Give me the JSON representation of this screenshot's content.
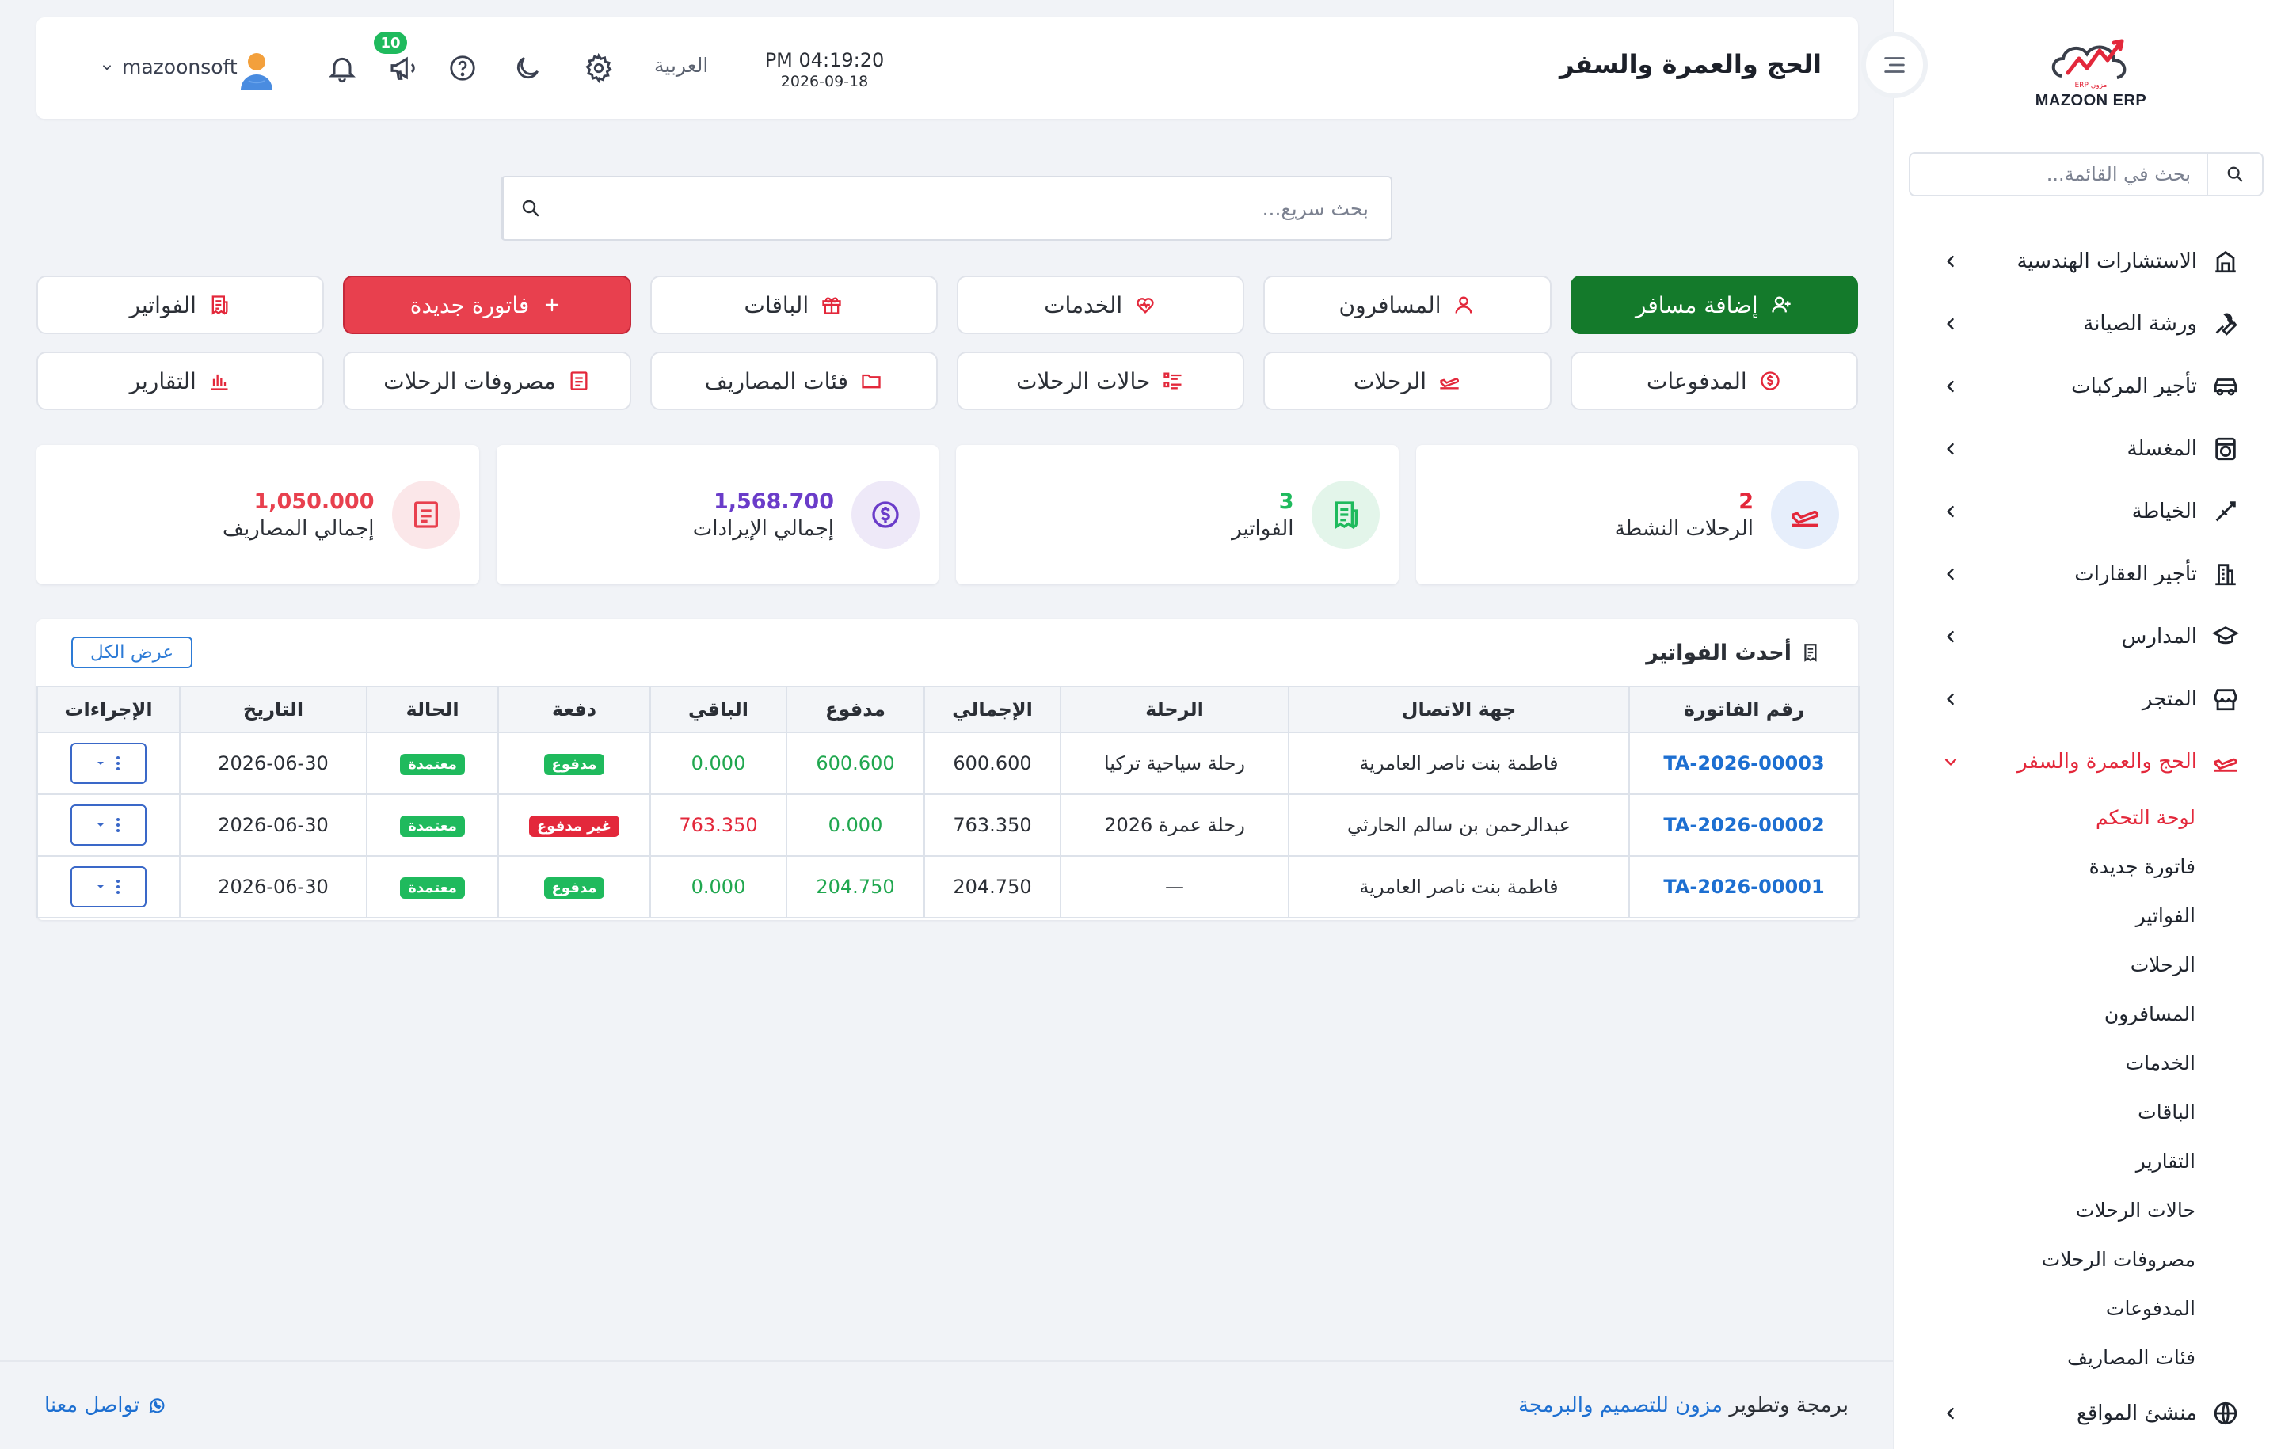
{
  "app": {
    "logo_text": "MAZOON ERP",
    "logo_subtext": "ERP مزون"
  },
  "header": {
    "page_title": "الحج والعمرة والسفر",
    "time": "PM 04:19:20",
    "date": "2026-09-18",
    "language": "العربية",
    "notification_count": "10",
    "username": "mazoonsoft"
  },
  "sidebar": {
    "search_placeholder": "بحث في القائمة...",
    "items": [
      {
        "label": "الاستشارات الهندسية",
        "icon": "building-columns-icon"
      },
      {
        "label": "ورشة الصيانة",
        "icon": "wrench-icon"
      },
      {
        "label": "تأجير المركبات",
        "icon": "car-icon"
      },
      {
        "label": "المغسلة",
        "icon": "laundry-icon"
      },
      {
        "label": "الخياطة",
        "icon": "needle-icon"
      },
      {
        "label": "تأجير العقارات",
        "icon": "buildings-icon"
      },
      {
        "label": "المدارس",
        "icon": "graduation-cap-icon"
      },
      {
        "label": "المتجر",
        "icon": "store-icon"
      },
      {
        "label": "الحج والعمرة والسفر",
        "icon": "plane-icon",
        "active": true
      }
    ],
    "sub_items": [
      "لوحة التحكم",
      "فاتورة جديدة",
      "الفواتير",
      "الرحلات",
      "المسافرون",
      "الخدمات",
      "الباقات",
      "التقارير",
      "حالات الرحلات",
      "مصروفات الرحلات",
      "المدفوعات",
      "فئات المصاريف"
    ],
    "last_item": {
      "label": "منشئ المواقع",
      "icon": "globe-icon"
    }
  },
  "quick_search": {
    "placeholder": "بحث سريع..."
  },
  "actions": {
    "add_traveler": "إضافة مسافر",
    "travelers": "المسافرون",
    "services": "الخدمات",
    "packages": "الباقات",
    "new_invoice": "فاتورة جديدة",
    "invoices": "الفواتير",
    "payments": "المدفوعات",
    "trips": "الرحلات",
    "trip_statuses": "حالات الرحلات",
    "expense_categories": "فئات المصاريف",
    "trip_expenses": "مصروفات الرحلات",
    "reports": "التقارير"
  },
  "stats": {
    "active_trips": {
      "value": "2",
      "label": "الرحلات النشطة",
      "color": "#e3283b"
    },
    "invoices": {
      "value": "3",
      "label": "الفواتير",
      "color": "#1fba5d"
    },
    "revenue": {
      "value": "1,568.700",
      "label": "إجمالي الإيرادات",
      "color": "#6a3cc9"
    },
    "expenses": {
      "value": "1,050.000",
      "label": "إجمالي المصاريف",
      "color": "#e8404e"
    }
  },
  "invoices_table": {
    "title": "أحدث الفواتير",
    "view_all": "عرض الكل",
    "columns": [
      "رقم الفاتورة",
      "جهة الاتصال",
      "الرحلة",
      "الإجمالي",
      "مدفوع",
      "الباقي",
      "دفعة",
      "الحالة",
      "التاريخ",
      "الإجراءات"
    ],
    "rows": [
      {
        "number": "TA-2026-00003",
        "contact": "فاطمة بنت ناصر العامرية",
        "trip": "رحلة سياحية تركيا",
        "total": "600.600",
        "paid": "600.600",
        "remaining": "0.000",
        "payment": "مدفوع",
        "payment_state": "paid",
        "status": "معتمدة",
        "date": "2026-06-30"
      },
      {
        "number": "TA-2026-00002",
        "contact": "عبدالرحمن بن سالم الحارثي",
        "trip": "رحلة عمرة 2026",
        "total": "763.350",
        "paid": "0.000",
        "remaining": "763.350",
        "payment": "غير مدفوع",
        "payment_state": "unpaid",
        "status": "معتمدة",
        "date": "2026-06-30"
      },
      {
        "number": "TA-2026-00001",
        "contact": "فاطمة بنت ناصر العامرية",
        "trip": "—",
        "total": "204.750",
        "paid": "204.750",
        "remaining": "0.000",
        "payment": "مدفوع",
        "payment_state": "paid",
        "status": "معتمدة",
        "date": "2026-06-30"
      }
    ]
  },
  "footer": {
    "credit_prefix": "برمجة وتطوير",
    "credit_link": "مزون للتصميم والبرمجة",
    "contact": "تواصل معنا"
  },
  "colors": {
    "accent_red": "#e3283b",
    "accent_green": "#147a2b",
    "link_blue": "#1d6fd1"
  }
}
